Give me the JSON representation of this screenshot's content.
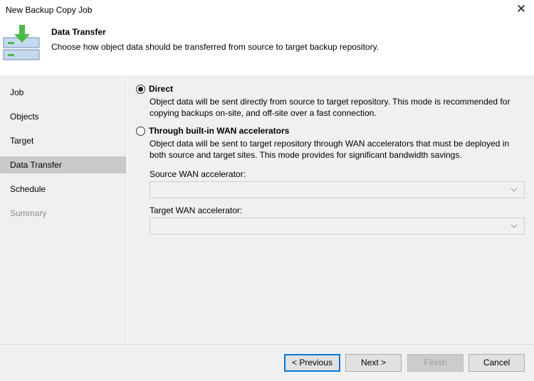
{
  "window": {
    "title": "New Backup Copy Job",
    "close_icon": "close-icon"
  },
  "header": {
    "icon": "backup-copy-icon",
    "title": "Data Transfer",
    "description": "Choose how object data should be transferred from source to target backup repository."
  },
  "sidebar": {
    "items": [
      {
        "label": "Job",
        "state": "normal"
      },
      {
        "label": "Objects",
        "state": "normal"
      },
      {
        "label": "Target",
        "state": "normal"
      },
      {
        "label": "Data Transfer",
        "state": "selected"
      },
      {
        "label": "Schedule",
        "state": "normal"
      },
      {
        "label": "Summary",
        "state": "disabled"
      }
    ]
  },
  "options": {
    "direct": {
      "label": "Direct",
      "selected": true,
      "description": "Object data will be sent directly from source to target repository. This mode is recommended for copying backups on-site, and off-site over a fast connection."
    },
    "wan": {
      "label": "Through built-in WAN accelerators",
      "selected": false,
      "description": "Object data will be sent to target repository through WAN accelerators that must be deployed in both source and target sites. This mode provides for significant bandwidth savings."
    }
  },
  "fields": {
    "source_label": "Source WAN accelerator:",
    "source_value": "",
    "target_label": "Target WAN accelerator:",
    "target_value": ""
  },
  "buttons": {
    "previous": "< Previous",
    "next": "Next >",
    "finish": "Finish",
    "cancel": "Cancel"
  },
  "colors": {
    "accent": "#0078d7",
    "icon_green": "#4cb848",
    "icon_blue": "#c5d9ef",
    "panel_bg": "#f0f0f0",
    "selected_bg": "#c9c9c9"
  }
}
